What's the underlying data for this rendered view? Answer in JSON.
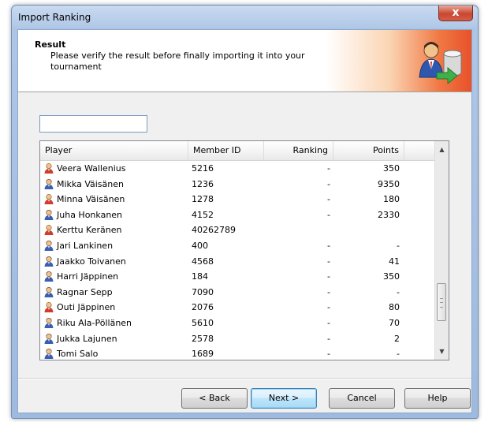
{
  "window": {
    "title": "Import Ranking",
    "close_label": "x"
  },
  "header": {
    "title": "Result",
    "description": "Please verify the result before finally importing it into your tournament"
  },
  "filter": {
    "value": ""
  },
  "table": {
    "columns": [
      "Player",
      "Member ID",
      "Ranking",
      "Points"
    ],
    "rows": [
      {
        "player": "Veera Wallenius",
        "member_id": "5216",
        "ranking": "-",
        "points": "350",
        "gender": "female"
      },
      {
        "player": "Mikka Väisänen",
        "member_id": "1236",
        "ranking": "-",
        "points": "9350",
        "gender": "male"
      },
      {
        "player": "Minna Väisänen",
        "member_id": "1278",
        "ranking": "-",
        "points": "180",
        "gender": "female"
      },
      {
        "player": "Juha Honkanen",
        "member_id": "4152",
        "ranking": "-",
        "points": "2330",
        "gender": "male"
      },
      {
        "player": "Kerttu Keränen",
        "member_id": "40262789",
        "ranking": "",
        "points": "",
        "gender": "female"
      },
      {
        "player": "Jari Lankinen",
        "member_id": "400",
        "ranking": "-",
        "points": "-",
        "gender": "male"
      },
      {
        "player": "Jaakko Toivanen",
        "member_id": "4568",
        "ranking": "-",
        "points": "41",
        "gender": "male"
      },
      {
        "player": "Harri Jäppinen",
        "member_id": "184",
        "ranking": "-",
        "points": "350",
        "gender": "male"
      },
      {
        "player": "Ragnar Sepp",
        "member_id": "7090",
        "ranking": "-",
        "points": "-",
        "gender": "male"
      },
      {
        "player": "Outi Jäppinen",
        "member_id": "2076",
        "ranking": "-",
        "points": "80",
        "gender": "female"
      },
      {
        "player": "Riku Ala-Pöllänen",
        "member_id": "5610",
        "ranking": "-",
        "points": "70",
        "gender": "male"
      },
      {
        "player": "Jukka Lajunen",
        "member_id": "2578",
        "ranking": "-",
        "points": "2",
        "gender": "male"
      },
      {
        "player": "Tomi Salo",
        "member_id": "1689",
        "ranking": "-",
        "points": "-",
        "gender": "male"
      }
    ]
  },
  "buttons": {
    "back": "< Back",
    "next": "Next >",
    "cancel": "Cancel",
    "help": "Help"
  },
  "colors": {
    "male_player": "#3a5fb0",
    "female_player": "#d13d2a",
    "header_accent": "#e8512a"
  }
}
